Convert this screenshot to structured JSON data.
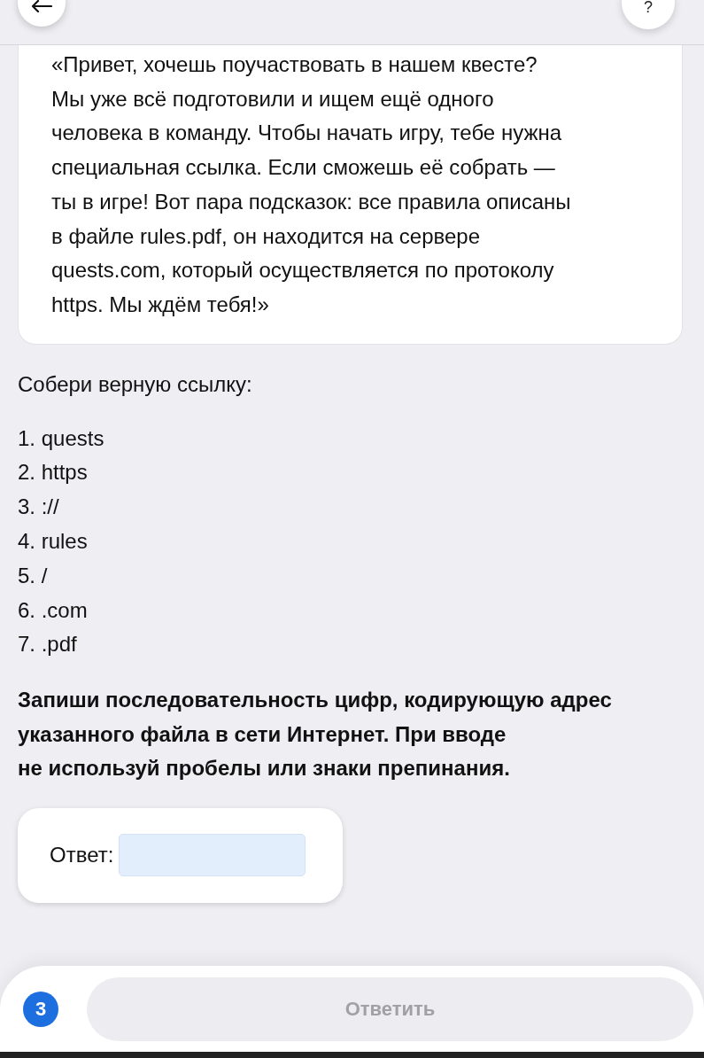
{
  "header": {
    "help_label": "?"
  },
  "message": {
    "text": "«Привет, хочешь поучаствовать в нашем квесте?\nМы уже всё подготовили и ищем ещё одного\nчеловека в команду. Чтобы начать игру, тебе нужна\nспециальная ссылка. Если сможешь её собрать —\nты в игре! Вот пара подсказок: все правила описаны\nв файле rules.pdf, он находится на сервере\nquests.com, который осуществляется по протоколу\nhttps. Мы ждём тебя!»"
  },
  "task": {
    "prompt": "Собери верную ссылку:",
    "options": [
      "1. quests",
      "2. https",
      "3. ://",
      "4. rules",
      "5. /",
      "6. .com",
      "7. .pdf"
    ],
    "instruction": "Запиши последовательность цифр, кодирующую адрес\nуказанного файла в сети Интернет. При вводе\nне используй пробелы или знаки препинания."
  },
  "answer": {
    "label": "Ответ:"
  },
  "footer": {
    "step": "3",
    "submit": {
      "label": "Ответить",
      "disabled": true
    }
  }
}
